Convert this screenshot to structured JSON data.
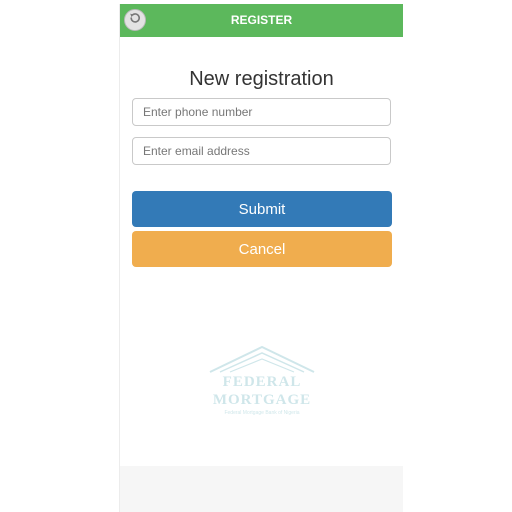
{
  "header": {
    "title": "REGISTER",
    "back_icon": "undo-arrow-icon",
    "color": "#5cb85c"
  },
  "form": {
    "title": "New registration",
    "phone_placeholder": "Enter phone number",
    "email_placeholder": "Enter email address"
  },
  "buttons": {
    "submit_label": "Submit",
    "submit_color": "#337ab7",
    "cancel_label": "Cancel",
    "cancel_color": "#f0ad4e"
  },
  "watermark": {
    "line1": "FEDERAL",
    "line2": "MORTGAGE",
    "subtitle": "Federal Mortgage Bank of Nigeria"
  }
}
